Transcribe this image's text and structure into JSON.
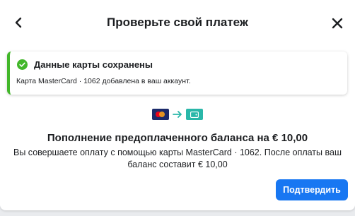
{
  "dialog": {
    "title": "Проверьте свой платеж",
    "back_icon": "chevron-left-icon",
    "close_icon": "close-icon"
  },
  "notice": {
    "icon": "check-circle-icon",
    "title": "Данные карты сохранены",
    "body": "Карта MasterCard · 1062 добавлена в ваш аккаунт.",
    "accent_color": "#42b72a"
  },
  "flow": {
    "from_icon": "mastercard-icon",
    "arrow_icon": "arrow-right-icon",
    "to_icon": "wallet-icon"
  },
  "payment": {
    "title": "Пополнение предоплаченного баланса на € 10,00",
    "description": "Вы совершаете оплату с помощью карты MasterCard · 1062. После оплаты ваш баланс составит € 10,00"
  },
  "actions": {
    "confirm_label": "Подтвердить",
    "confirm_color": "#1877f2"
  }
}
